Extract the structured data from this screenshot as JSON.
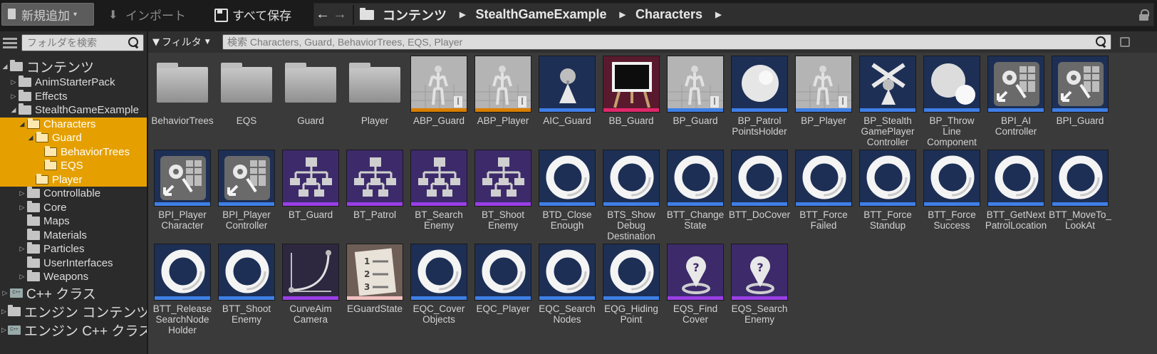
{
  "toolbar": {
    "add_new_label": "新規追加",
    "import_label": "インポート",
    "save_all_label": "すべて保存"
  },
  "breadcrumb": [
    "コンテンツ",
    "StealthGameExample",
    "Characters"
  ],
  "sidebar": {
    "search_placeholder": "フォルダを検索",
    "tree": [
      {
        "label": "コンテンツ",
        "depth": 0,
        "expanded": true,
        "selected": false,
        "big": true,
        "icon": "folder-icon"
      },
      {
        "label": "AnimStarterPack",
        "depth": 1,
        "expanded": false,
        "selected": false,
        "icon": "folder-icon"
      },
      {
        "label": "Effects",
        "depth": 1,
        "expanded": false,
        "selected": false,
        "icon": "folder-icon"
      },
      {
        "label": "StealthGameExample",
        "depth": 1,
        "expanded": true,
        "selected": false,
        "icon": "folder-icon"
      },
      {
        "label": "Characters",
        "depth": 2,
        "expanded": true,
        "selected": true,
        "icon": "folder-icon"
      },
      {
        "label": "Guard",
        "depth": 3,
        "expanded": true,
        "selected": true,
        "icon": "folder-icon"
      },
      {
        "label": "BehaviorTrees",
        "depth": 4,
        "expanded": null,
        "selected": true,
        "icon": "folder-icon"
      },
      {
        "label": "EQS",
        "depth": 4,
        "expanded": null,
        "selected": true,
        "icon": "folder-icon"
      },
      {
        "label": "Player",
        "depth": 3,
        "expanded": null,
        "selected": true,
        "icon": "folder-icon"
      },
      {
        "label": "Controllable",
        "depth": 2,
        "expanded": false,
        "selected": false,
        "icon": "folder-icon"
      },
      {
        "label": "Core",
        "depth": 2,
        "expanded": false,
        "selected": false,
        "icon": "folder-icon"
      },
      {
        "label": "Maps",
        "depth": 2,
        "expanded": null,
        "selected": false,
        "icon": "folder-icon"
      },
      {
        "label": "Materials",
        "depth": 2,
        "expanded": null,
        "selected": false,
        "icon": "folder-icon"
      },
      {
        "label": "Particles",
        "depth": 2,
        "expanded": false,
        "selected": false,
        "icon": "folder-icon"
      },
      {
        "label": "UserInterfaces",
        "depth": 2,
        "expanded": null,
        "selected": false,
        "icon": "folder-icon"
      },
      {
        "label": "Weapons",
        "depth": 2,
        "expanded": false,
        "selected": false,
        "icon": "folder-icon"
      },
      {
        "label": "C++ クラス",
        "depth": 0,
        "expanded": false,
        "selected": false,
        "big": true,
        "icon": "cpp-icon"
      },
      {
        "label": "エンジン コンテンツ",
        "depth": 0,
        "expanded": false,
        "selected": false,
        "big": true,
        "icon": "folder-icon"
      },
      {
        "label": "エンジン C++ クラス",
        "depth": 0,
        "expanded": false,
        "selected": false,
        "big": true,
        "icon": "cpp-icon"
      }
    ]
  },
  "content": {
    "filter_label": "フィルタ",
    "search_placeholder": "検索 Characters, Guard, BehaviorTrees, EQS, Player",
    "assets": [
      {
        "name": "BehaviorTrees",
        "kind": "folder"
      },
      {
        "name": "EQS",
        "kind": "folder"
      },
      {
        "name": "Guard",
        "kind": "folder"
      },
      {
        "name": "Player",
        "kind": "folder"
      },
      {
        "name": "ABP_Guard",
        "kind": "anim",
        "strip": "#d97f00"
      },
      {
        "name": "ABP_Player",
        "kind": "anim",
        "strip": "#d97f00"
      },
      {
        "name": "AIC_Guard",
        "kind": "aic",
        "strip": "#3f7fe6"
      },
      {
        "name": "BB_Guard",
        "kind": "blackboard",
        "strip": "#e0286a"
      },
      {
        "name": "BP_Guard",
        "kind": "character",
        "strip": "#3f7fe6"
      },
      {
        "name": "BP_Patrol\nPointsHolder",
        "kind": "sphere",
        "strip": "#3f7fe6"
      },
      {
        "name": "BP_Player",
        "kind": "character",
        "strip": "#3f7fe6"
      },
      {
        "name": "BP_Stealth\nGamePlayer\nController",
        "kind": "controller",
        "strip": "#3f7fe6"
      },
      {
        "name": "BP_Throw\nLine\nComponent",
        "kind": "spheres",
        "strip": "#3f7fe6"
      },
      {
        "name": "BPI_AI\nController",
        "kind": "interface",
        "strip": "#3f7fe6"
      },
      {
        "name": "BPI_Guard",
        "kind": "interface",
        "strip": "#3f7fe6"
      },
      {
        "name": "BPI_Player\nCharacter",
        "kind": "interface",
        "strip": "#3f7fe6"
      },
      {
        "name": "BPI_Player\nController",
        "kind": "interface",
        "strip": "#3f7fe6"
      },
      {
        "name": "BT_Guard",
        "kind": "tree",
        "strip": "#9a3fe6"
      },
      {
        "name": "BT_Patrol",
        "kind": "tree",
        "strip": "#9a3fe6"
      },
      {
        "name": "BT_Search\nEnemy",
        "kind": "tree",
        "strip": "#9a3fe6"
      },
      {
        "name": "BT_Shoot\nEnemy",
        "kind": "tree",
        "strip": "#9a3fe6"
      },
      {
        "name": "BTD_Close\nEnough",
        "kind": "ring",
        "strip": "#3f7fe6"
      },
      {
        "name": "BTS_Show\nDebug\nDestination",
        "kind": "ring",
        "strip": "#3f7fe6"
      },
      {
        "name": "BTT_Change\nState",
        "kind": "ring",
        "strip": "#3f7fe6"
      },
      {
        "name": "BTT_DoCover",
        "kind": "ring",
        "strip": "#3f7fe6"
      },
      {
        "name": "BTT_Force\nFailed",
        "kind": "ring",
        "strip": "#3f7fe6"
      },
      {
        "name": "BTT_Force\nStandup",
        "kind": "ring",
        "strip": "#3f7fe6"
      },
      {
        "name": "BTT_Force\nSuccess",
        "kind": "ring",
        "strip": "#3f7fe6"
      },
      {
        "name": "BTT_GetNext\nPatrolLocation",
        "kind": "ring",
        "strip": "#3f7fe6"
      },
      {
        "name": "BTT_MoveTo_\nLookAt",
        "kind": "ring",
        "strip": "#3f7fe6"
      },
      {
        "name": "BTT_Release\nSearchNode\nHolder",
        "kind": "ring",
        "strip": "#3f7fe6"
      },
      {
        "name": "BTT_Shoot\nEnemy",
        "kind": "ring",
        "strip": "#3f7fe6"
      },
      {
        "name": "CurveAim\nCamera",
        "kind": "curve",
        "strip": "#9a3fe6"
      },
      {
        "name": "EGuardState",
        "kind": "enum",
        "strip": "#f2c0c0"
      },
      {
        "name": "EQC_Cover\nObjects",
        "kind": "ring",
        "strip": "#3f7fe6"
      },
      {
        "name": "EQC_Player",
        "kind": "ring",
        "strip": "#3f7fe6"
      },
      {
        "name": "EQC_Search\nNodes",
        "kind": "ring",
        "strip": "#3f7fe6"
      },
      {
        "name": "EQG_Hiding\nPoint",
        "kind": "ring",
        "strip": "#3f7fe6"
      },
      {
        "name": "EQS_Find\nCover",
        "kind": "eqs",
        "strip": "#9a3fe6"
      },
      {
        "name": "EQS_Search\nEnemy",
        "kind": "eqs",
        "strip": "#9a3fe6"
      }
    ]
  }
}
